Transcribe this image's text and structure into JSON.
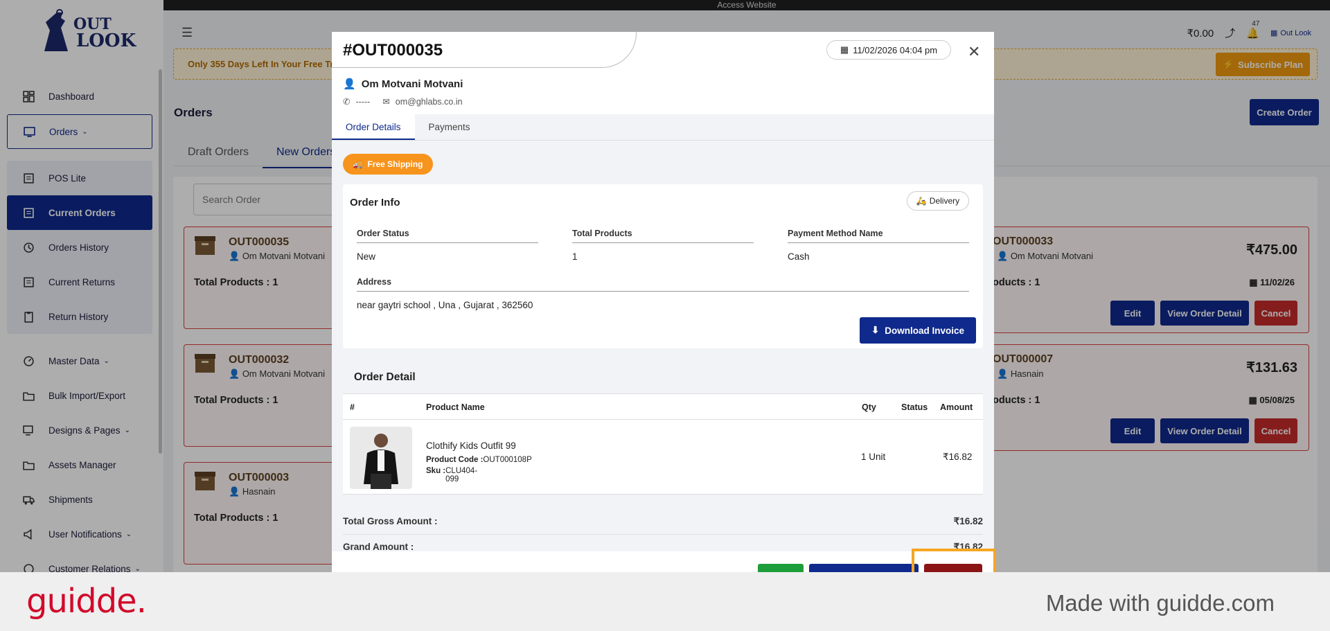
{
  "topbar": {
    "label": "Access Website"
  },
  "logo": {
    "text_top": "OUT",
    "text_bottom": "LOOK"
  },
  "sidebar": {
    "items": [
      {
        "label": "Dashboard"
      },
      {
        "label": "Orders"
      },
      {
        "label": "POS Lite"
      },
      {
        "label": "Current Orders"
      },
      {
        "label": "Orders History"
      },
      {
        "label": "Current Returns"
      },
      {
        "label": "Return History"
      },
      {
        "label": "Master Data"
      },
      {
        "label": "Bulk Import/Export"
      },
      {
        "label": "Designs & Pages"
      },
      {
        "label": "Assets Manager"
      },
      {
        "label": "Shipments"
      },
      {
        "label": "User Notifications"
      },
      {
        "label": "Customer Relations"
      }
    ]
  },
  "header": {
    "wallet": "₹0.00",
    "notif_count": "47",
    "store_name": "Out Look"
  },
  "trial": {
    "text": "Only 355 Days Left In Your Free Tria",
    "subscribe_label": "Subscribe Plan"
  },
  "page": {
    "title": "Orders",
    "create_label": "Create Order",
    "tabs": [
      "Draft Orders",
      "New Orders"
    ],
    "search_placeholder": "Search Order"
  },
  "left_cards": [
    {
      "id": "OUT000035",
      "customer": "Om Motvani Motvani",
      "total": "Total Products : 1"
    },
    {
      "id": "OUT000032",
      "customer": "Om Motvani Motvani",
      "total": "Total Products : 1"
    },
    {
      "id": "OUT000003",
      "customer": "Hasnain",
      "total": "Total Products : 1"
    }
  ],
  "right_cards": [
    {
      "id": "OUT000033",
      "customer": "Om Motvani Motvani",
      "amount": "₹475.00",
      "total": "oducts : 1",
      "date": "11/02/26",
      "edit": "Edit",
      "view": "View Order Detail",
      "cancel": "Cancel"
    },
    {
      "id": "OUT000007",
      "customer": "Hasnain",
      "amount": "₹131.63",
      "total": "oducts : 1",
      "date": "05/08/25",
      "edit": "Edit",
      "view": "View Order Detail",
      "cancel": "Cancel"
    }
  ],
  "modal": {
    "order_id": "#OUT000035",
    "datetime": "11/02/2026 04:04 pm",
    "customer": "Om Motvani Motvani",
    "phone": "-----",
    "email": "om@ghlabs.co.in",
    "tabs": [
      "Order Details",
      "Payments"
    ],
    "badge": "Free Shipping",
    "info": {
      "title": "Order Info",
      "delivery": "Delivery",
      "status_label": "Order Status",
      "status_value": "New",
      "products_label": "Total Products",
      "products_value": "1",
      "payment_label": "Payment Method Name",
      "payment_value": "Cash",
      "address_label": "Address",
      "address_value": "near gaytri school , Una , Gujarat , 362560",
      "download_label": "Download Invoice"
    },
    "detail": {
      "title": "Order Detail",
      "headers": {
        "num": "#",
        "name": "Product Name",
        "qty": "Qty",
        "status": "Status",
        "amount": "Amount"
      },
      "row": {
        "name": "Clothify Kids Outfit 99",
        "code_label": "Product Code :",
        "code": "OUT000108P",
        "sku_label": "Sku :",
        "sku": "CLU404-099",
        "qty": "1 Unit",
        "amount": "₹16.82"
      }
    },
    "totals": {
      "gross_label": "Total Gross Amount :",
      "gross": "₹16.82",
      "grand_label": "Grand Amount :",
      "grand": "₹16.82"
    }
  },
  "footer": {
    "brand": "guidde.",
    "made_with": "Made with guidde.com"
  }
}
